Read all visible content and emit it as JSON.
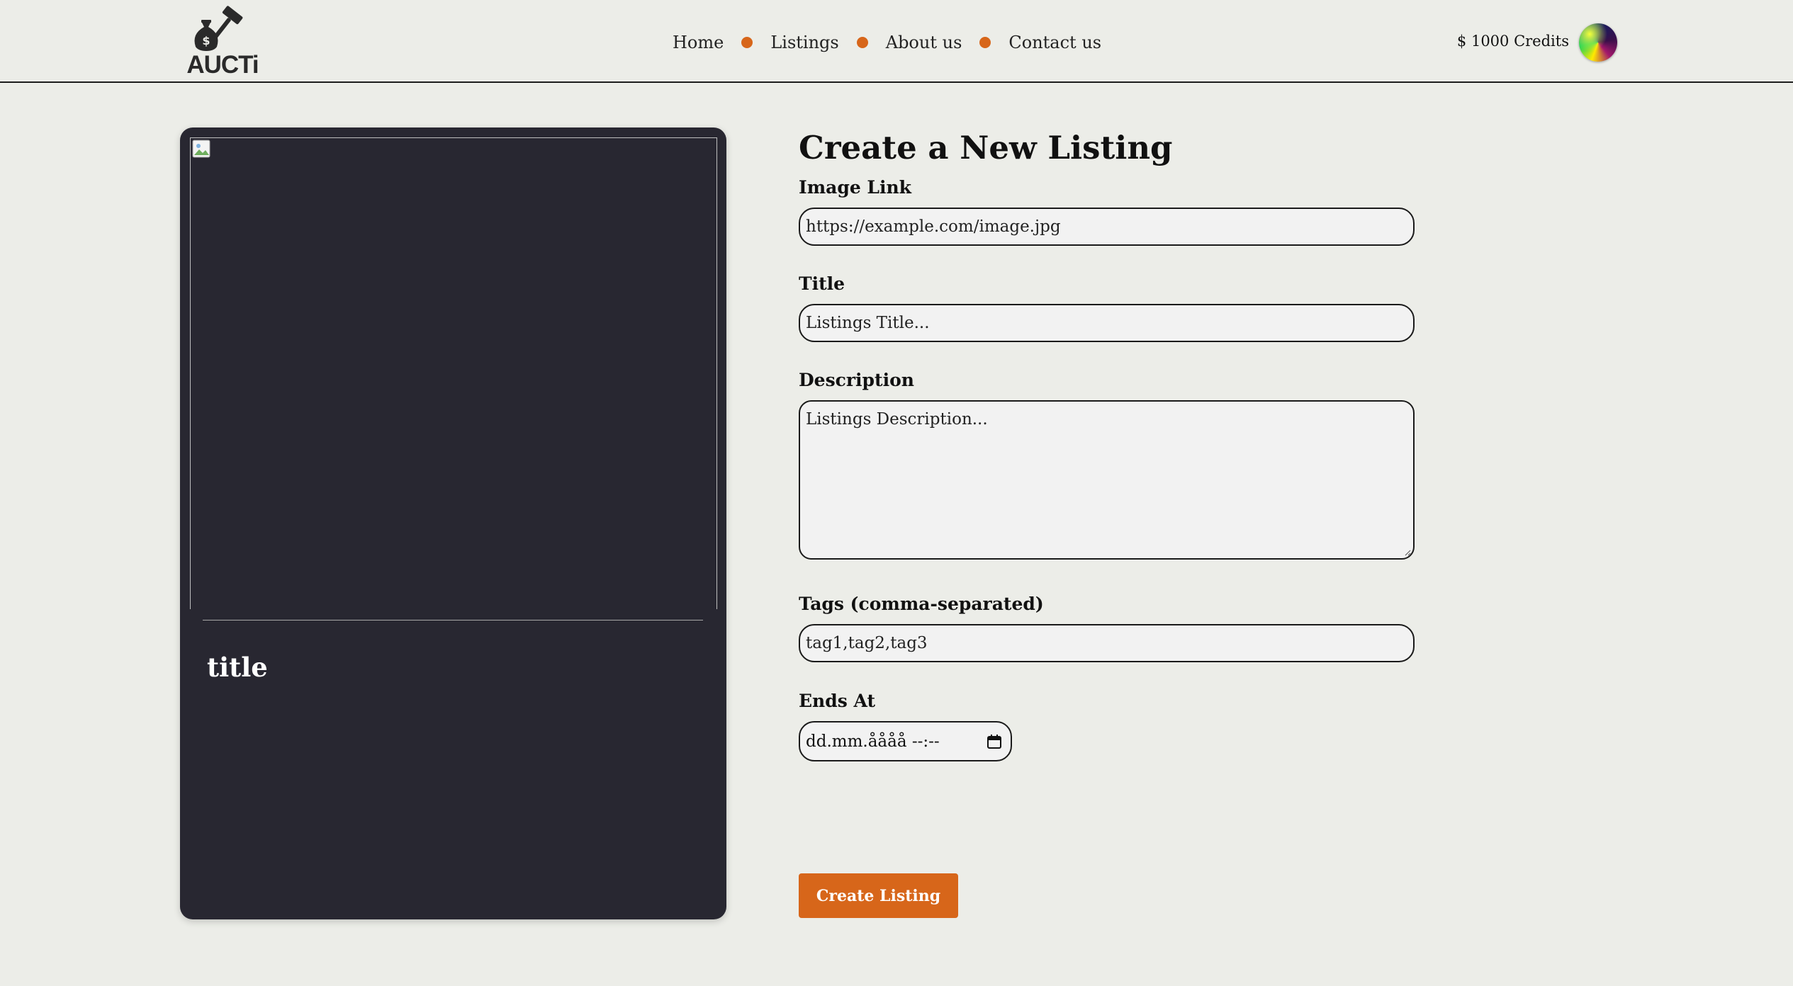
{
  "header": {
    "logo_text": "AUCTi",
    "nav": [
      {
        "label": "Home"
      },
      {
        "label": "Listings"
      },
      {
        "label": "About us"
      },
      {
        "label": "Contact us"
      }
    ],
    "credits": "$ 1000 Credits",
    "accent_color": "#D7661A"
  },
  "preview": {
    "title": "title",
    "image_icon": "broken-image-icon"
  },
  "form": {
    "heading": "Create a New Listing",
    "image_link": {
      "label": "Image Link",
      "value": "https://example.com/image.jpg"
    },
    "title": {
      "label": "Title",
      "placeholder": "Listings Title..."
    },
    "description": {
      "label": "Description",
      "placeholder": "Listings Description..."
    },
    "tags": {
      "label": "Tags (comma-separated)",
      "value": "tag1,tag2,tag3"
    },
    "ends_at": {
      "label": "Ends At",
      "value": "dd.mm.åååå --:--"
    },
    "submit_label": "Create Listing"
  }
}
